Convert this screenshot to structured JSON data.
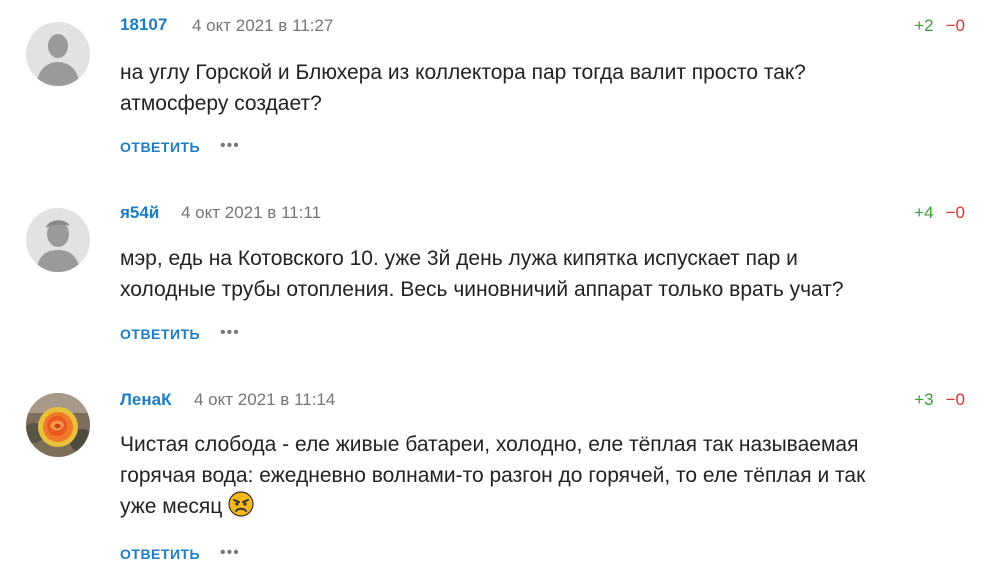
{
  "comments": [
    {
      "username": "18107",
      "date": "4 окт 2021 в 11:27",
      "up": "+2",
      "down": "−0",
      "line1": "на углу Горской и Блюхера из коллектора пар тогда валит просто так?",
      "line2": "атмосферу создает?",
      "reply": "ОТВЕТИТЬ",
      "more": "•••",
      "avatar": "default-user-icon"
    },
    {
      "username": "я54й",
      "date": "4 окт 2021 в 11:11",
      "up": "+4",
      "down": "−0",
      "line1": "мэр, едь на Котовского 10. уже 3й день лужа кипятка испускает пар и",
      "line2": "холодные трубы отопления. Весь чиновничий аппарат только врать учат?",
      "reply": "ОТВЕТИТЬ",
      "more": "•••",
      "avatar": "default-user-icon"
    },
    {
      "username": "ЛенаК",
      "date": "4 окт 2021 в 11:14",
      "up": "+3",
      "down": "−0",
      "line1": "Чистая слобода - еле живые батареи, холодно, еле тёплая так называемая",
      "line2": "горячая вода: ежедневно волнами-то разгон до горячей, то еле тёплая и так",
      "line3": "уже месяц",
      "emoji": "angry-face-icon",
      "reply": "ОТВЕТИТЬ",
      "more": "•••",
      "avatar": "rose-photo"
    }
  ],
  "colors": {
    "link": "#1c7dc4",
    "upvote": "#3aa03a",
    "downvote": "#d33333",
    "date": "#757575"
  }
}
